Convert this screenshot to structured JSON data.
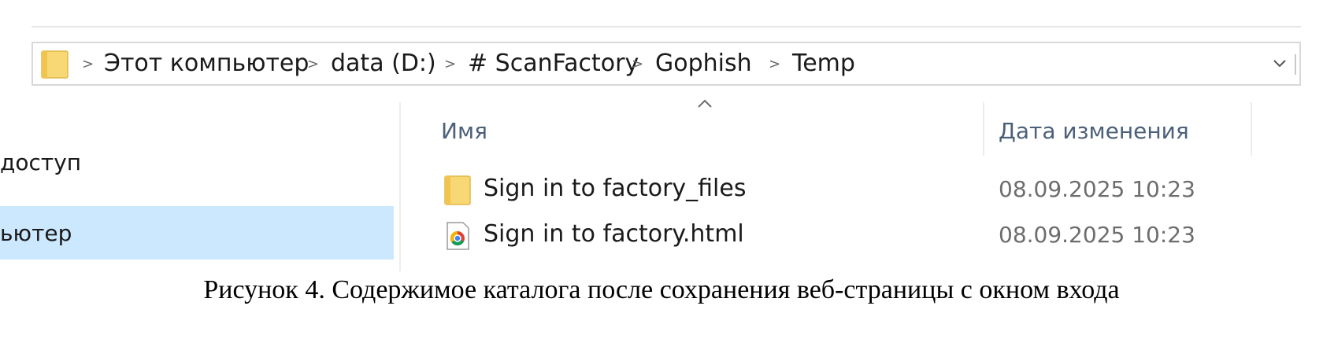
{
  "address_bar": {
    "icon": "folder-icon",
    "separator": ">",
    "crumbs": [
      "Этот компьютер",
      "data (D:)",
      "# ScanFactory",
      "Gophish",
      "Temp"
    ],
    "dropdown_icon": "chevron-down-icon"
  },
  "nav_pane": {
    "items": [
      {
        "label": "доступ",
        "selected": false
      },
      {
        "label": "ьютер",
        "selected": true
      }
    ]
  },
  "file_list": {
    "columns": {
      "name": "Имя",
      "date": "Дата изменения"
    },
    "sort_icon": "sort-ascending-icon",
    "rows": [
      {
        "icon": "folder-icon",
        "name": "Sign in to factory_files",
        "date": "08.09.2025 10:23"
      },
      {
        "icon": "chrome-html-icon",
        "name": "Sign in to factory.html",
        "date": "08.09.2025 10:23"
      }
    ]
  },
  "caption": "Рисунок 4. Содержимое каталога после сохранения веб-страницы с окном входа",
  "colors": {
    "selection": "#cce8ff",
    "folder_yellow": "#f8d775",
    "header_text": "#4c607a"
  }
}
